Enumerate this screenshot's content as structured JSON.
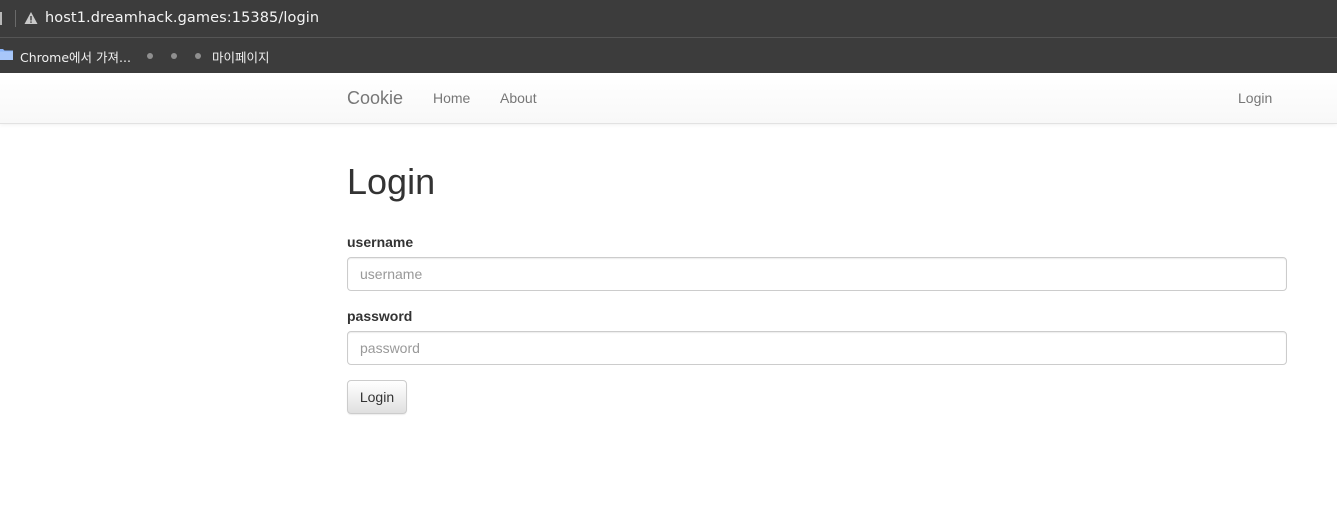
{
  "browser": {
    "url": "host1.dreamhack.games:15385/login",
    "bookmarks": {
      "import_label": "Chrome에서 가져...",
      "mypage_label": "마이페이지"
    }
  },
  "navbar": {
    "brand": "Cookie",
    "links": [
      "Home",
      "About"
    ],
    "right_link": "Login"
  },
  "main": {
    "title": "Login",
    "username": {
      "label": "username",
      "placeholder": "username",
      "value": ""
    },
    "password": {
      "label": "password",
      "placeholder": "password",
      "value": ""
    },
    "submit_label": "Login"
  },
  "colors": {
    "chrome_background": "#3c3c3c",
    "navbar_text": "#777777",
    "body_text": "#333333"
  }
}
